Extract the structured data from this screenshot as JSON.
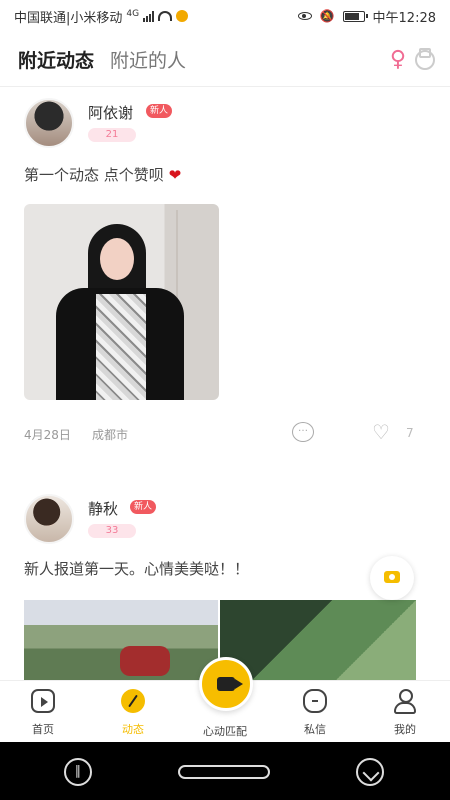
{
  "status_bar": {
    "carrier": "中国联通|小米移动",
    "signal": "4G",
    "time": "中午12:28"
  },
  "header": {
    "tabs": [
      {
        "label": "附近动态",
        "active": true
      },
      {
        "label": "附近的人",
        "active": false
      }
    ]
  },
  "posts": [
    {
      "username": "阿依谢",
      "badge": "新人",
      "age": "21",
      "text": "第一个动态 点个赞呗",
      "heart": "❤",
      "date": "4月28日",
      "city": "成都市",
      "comment_icon": "comment-icon",
      "like_count": "7"
    },
    {
      "username": "静秋",
      "badge": "新人",
      "age": "33",
      "text": "新人报道第一天。心情美美哒！！"
    }
  ],
  "bottom_nav": {
    "items": [
      {
        "label": "首页"
      },
      {
        "label": "动态",
        "active": true
      },
      {
        "label": "心动匹配"
      },
      {
        "label": "私信"
      },
      {
        "label": "我的"
      }
    ]
  },
  "colors": {
    "accent": "#f7bd00",
    "pink": "#f06c93",
    "badge": "#f1595f"
  }
}
